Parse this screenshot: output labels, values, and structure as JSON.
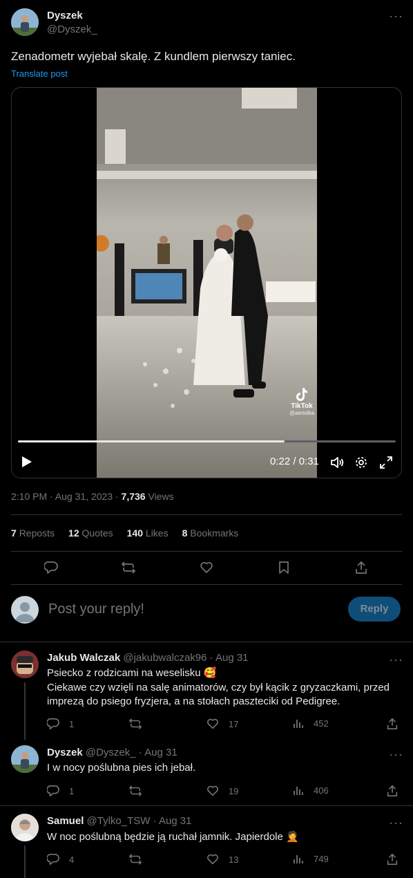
{
  "post": {
    "author_name": "Dyszek",
    "author_handle": "@Dyszek_",
    "text": "Zenadometr wyjebał skalę. Z kundlem pierwszy taniec.",
    "translate_label": "Translate post",
    "timestamp": "2:10 PM · Aug 31, 2023 · ",
    "views_count": "7,736",
    "views_label": " Views"
  },
  "video": {
    "time_display": "0:22 / 0:31",
    "progress": 0.705,
    "tiktok_label": "TikTok",
    "tiktok_user": "@aerielka"
  },
  "stats": {
    "reposts_count": "7",
    "reposts_label": "Reposts",
    "quotes_count": "12",
    "quotes_label": "Quotes",
    "likes_count": "140",
    "likes_label": "Likes",
    "bookmarks_count": "8",
    "bookmarks_label": "Bookmarks"
  },
  "compose": {
    "placeholder": "Post your reply!",
    "reply_button": "Reply"
  },
  "replies": [
    {
      "name": "Jakub Walczak",
      "handle": "@jakubwalczak96",
      "date": " · Aug 31",
      "line1": "Psiecko z rodzicami na weselisku 🥰",
      "line2": "Ciekawe czy wzięli na salę animatorów, czy był kącik z gryzaczkami, przed imprezą do psiego fryzjera, a na stołach paszteciki od Pedigree.",
      "replies": "1",
      "reposts": "",
      "likes": "17",
      "views": "452"
    },
    {
      "name": "Dyszek",
      "handle": "@Dyszek_",
      "date": " · Aug 31",
      "line1": "I w nocy poślubna pies ich jebał.",
      "replies": "1",
      "reposts": "",
      "likes": "19",
      "views": "406"
    },
    {
      "name": "Samuel",
      "handle": "@Tylko_TSW",
      "date": " · Aug 31",
      "line1": "W noc poślubną będzie ją ruchał jamnik. Japierdole 🤦",
      "replies": "4",
      "reposts": "",
      "likes": "13",
      "views": "749"
    }
  ],
  "colors": {
    "accent": "#1d9bf0",
    "reply_button_bg": "#0f4e78",
    "divider": "#2f3336",
    "muted": "#71767b"
  }
}
